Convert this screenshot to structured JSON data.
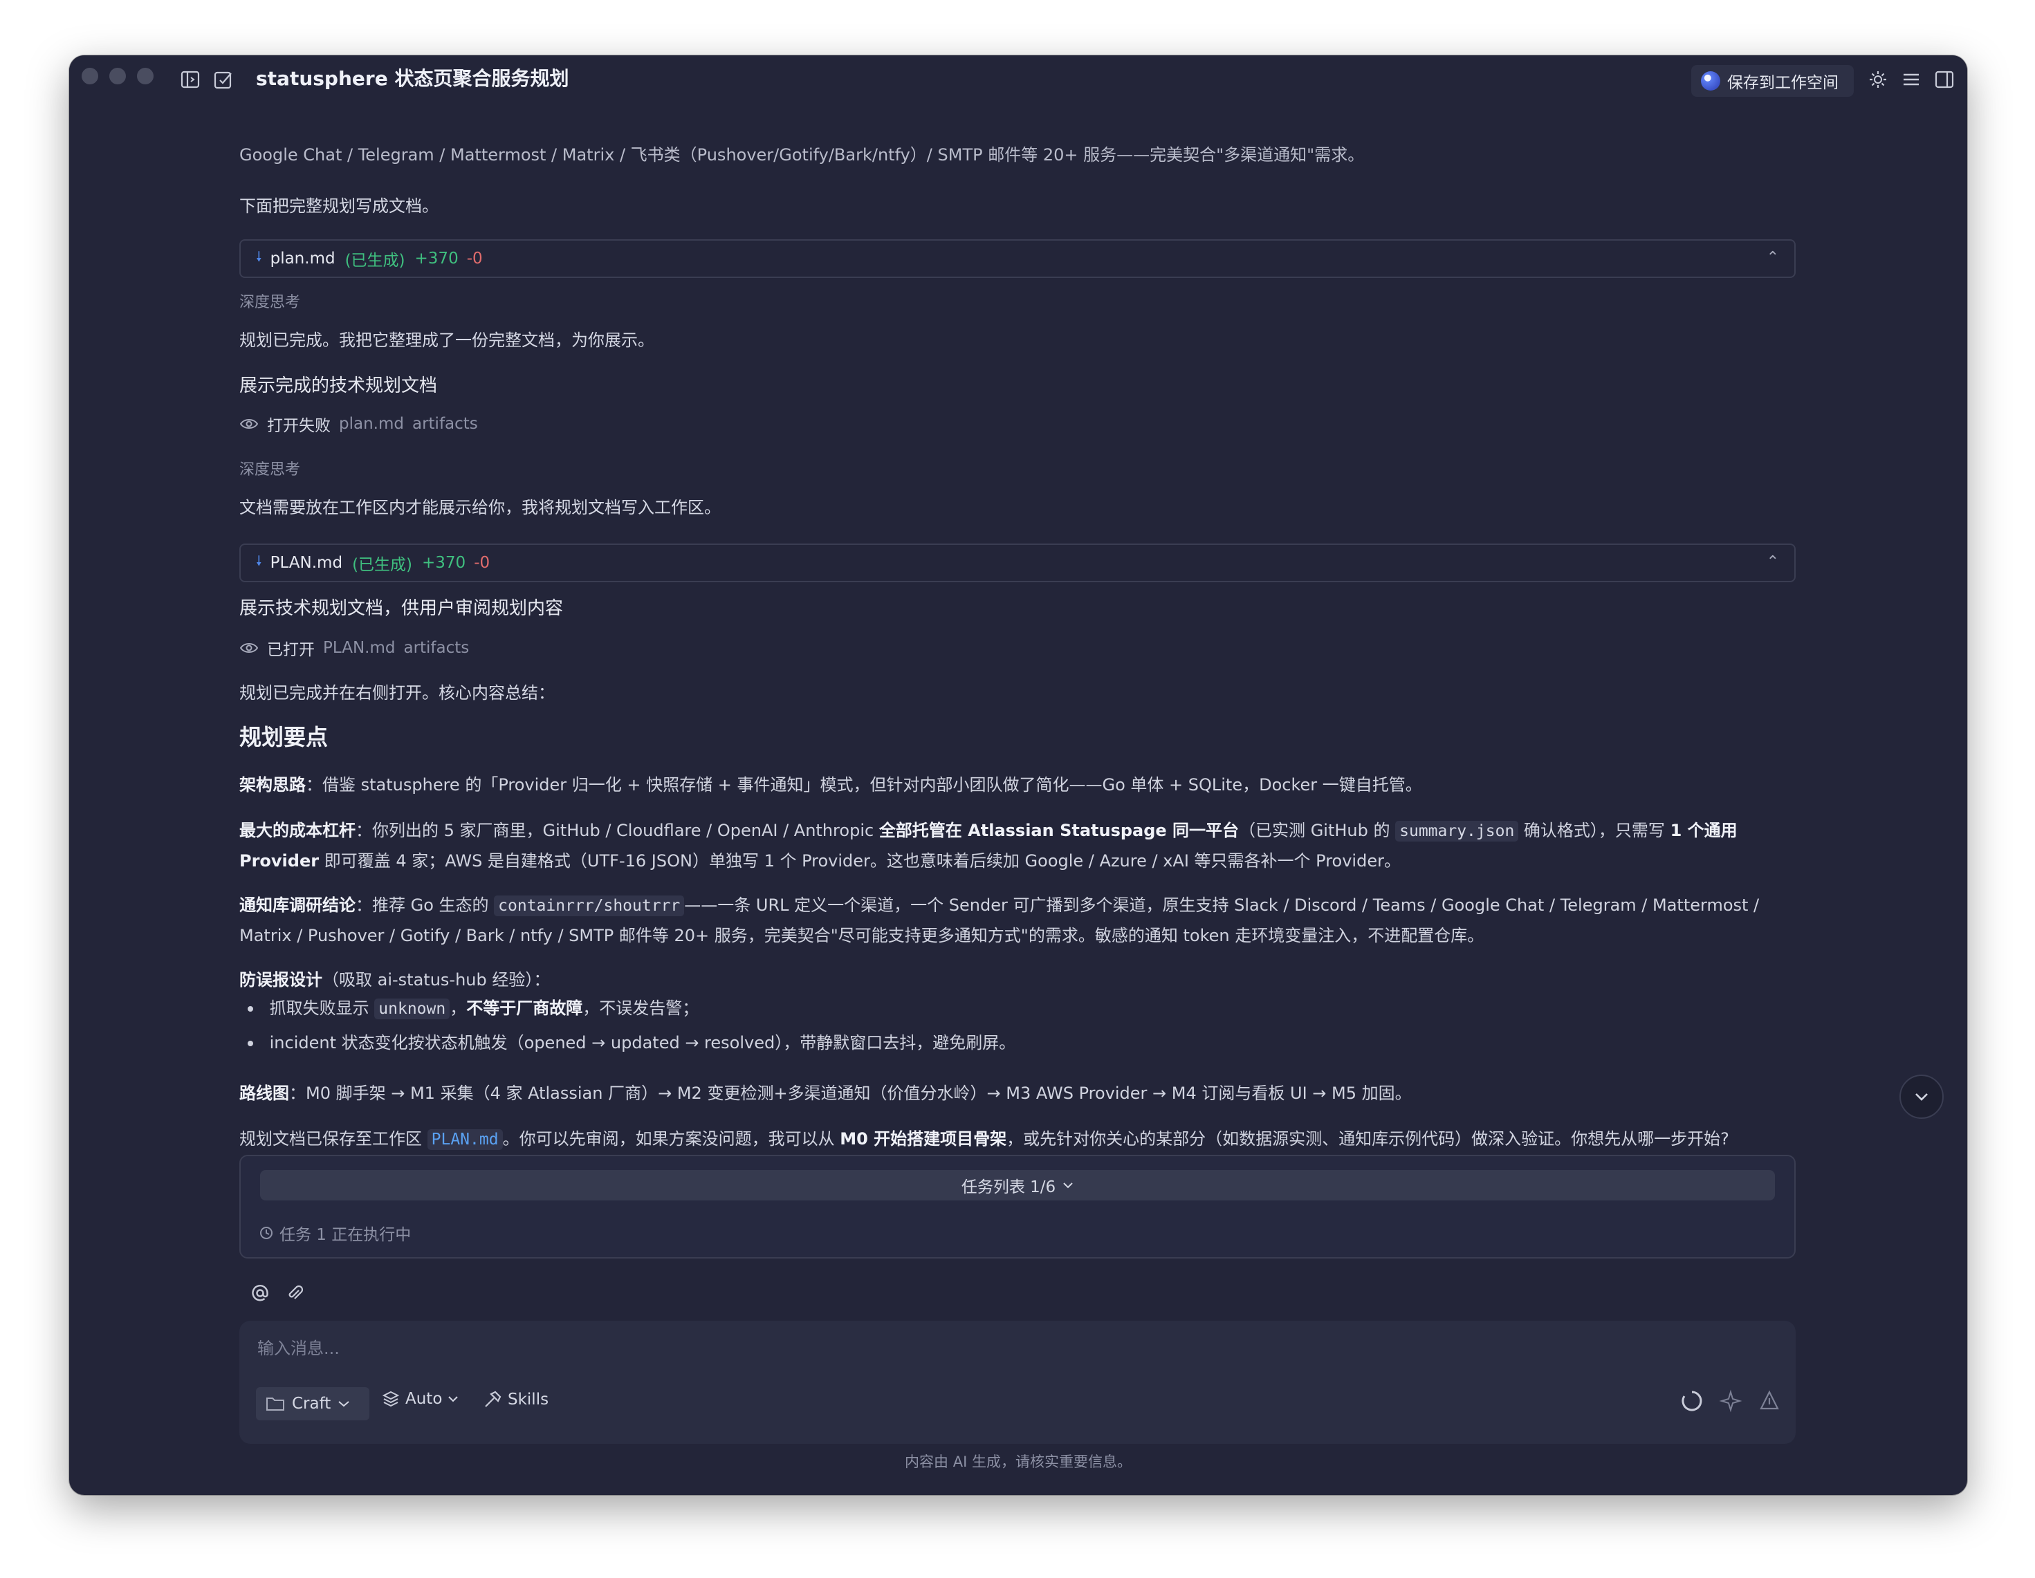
{
  "window": {
    "title": "statusphere 状态页聚合服务规划",
    "save_button": "保存到工作空间"
  },
  "content": {
    "clipped_line": "Google Chat / Telegram / Mattermost / Matrix / 飞书类（Pushover/Gotify/Bark/ntfy）/ SMTP 邮件等 20+ 服务——完美契合\"多渠道通知\"需求。",
    "intro": "下面把完整规划写成文档。",
    "file1": {
      "name": "plan.md",
      "status": "(已生成)",
      "added": "+370",
      "removed": "-0"
    },
    "think1": "深度思考",
    "msg1": "规划已完成。我把它整理成了一份完整文档，为你展示。",
    "action1": "展示完成的技术规划文档",
    "open1": {
      "label": "打开失败",
      "file": "plan.md",
      "kind": "artifacts"
    },
    "think2": "深度思考",
    "msg2": "文档需要放在工作区内才能展示给你，我将规划文档写入工作区。",
    "file2": {
      "name": "PLAN.md",
      "status": "(已生成)",
      "added": "+370",
      "removed": "-0"
    },
    "action2": "展示技术规划文档，供用户审阅规划内容",
    "open2": {
      "label": "已打开",
      "file": "PLAN.md",
      "kind": "artifacts"
    },
    "summary_intro": "规划已完成并在右侧打开。核心内容总结：",
    "heading": "规划要点",
    "arch": {
      "label": "架构思路",
      "text": "：借鉴 statusphere 的「Provider 归一化 + 快照存储 + 事件通知」模式，但针对内部小团队做了简化——Go 单体 + SQLite，Docker 一键自托管。"
    },
    "cost": {
      "label": "最大的成本杠杆",
      "t1": "：你列出的 5 家厂商里，GitHub / Cloudflare / OpenAI / Anthropic ",
      "b1": "全部托管在 Atlassian Statuspage 同一平台",
      "t2": "（已实测 GitHub 的 ",
      "code": "summary.json",
      "t3": " 确认格式），只需写 ",
      "b2": "1 个通用 Provider",
      "t4": " 即可覆盖 4 家；AWS 是自建格式（UTF-16 JSON）单独写 1 个 Provider。这也意味着后续加 Google / Azure / xAI 等只需各补一个 Provider。"
    },
    "notify": {
      "label": "通知库调研结论",
      "t1": "：推荐 Go 生态的 ",
      "code": "containrrr/shoutrrr",
      "t2": "——一条 URL 定义一个渠道，一个 Sender 可广播到多个渠道，原生支持 Slack / Discord / Teams / Google Chat / Telegram / Mattermost / Matrix / Pushover / Gotify / Bark / ntfy / SMTP 邮件等 20+ 服务，完美契合\"尽可能支持更多通知方式\"的需求。敏感的通知 token 走环境变量注入，不进配置仓库。"
    },
    "fp": {
      "label": "防误报设计",
      "text": "（吸取 ai-status-hub 经验）："
    },
    "bullet1": {
      "t1": "抓取失败显示 ",
      "code": "unknown",
      "t2": "，",
      "b": "不等于厂商故障",
      "t3": "，不误发告警；"
    },
    "bullet2": "incident 状态变化按状态机触发（opened → updated → resolved），带静默窗口去抖，避免刷屏。",
    "roadmap": {
      "label": "路线图",
      "text": "：M0 脚手架 → M1 采集（4 家 Atlassian 厂商）→ M2 变更检测+多渠道通知（价值分水岭）→ M3 AWS Provider → M4 订阅与看板 UI → M5 加固。"
    },
    "closing": {
      "t1": "规划文档已保存至工作区 ",
      "code": "PLAN.md",
      "t2": "。你可以先审阅，如果方案没问题，我可以从 ",
      "b": "M0 开始搭建项目骨架",
      "t3": "，或先针对你关心的某部分（如数据源实测、通知库示例代码）做深入验证。你想先从哪一步开始?"
    }
  },
  "tasks": {
    "bar_label": "任务列表 1/6",
    "status": "任务 1 正在执行中"
  },
  "composer": {
    "placeholder": "输入消息...",
    "mode": "Craft",
    "model": "Auto",
    "skills": "Skills"
  },
  "disclaimer": "内容由 AI 生成，请核实重要信息。"
}
